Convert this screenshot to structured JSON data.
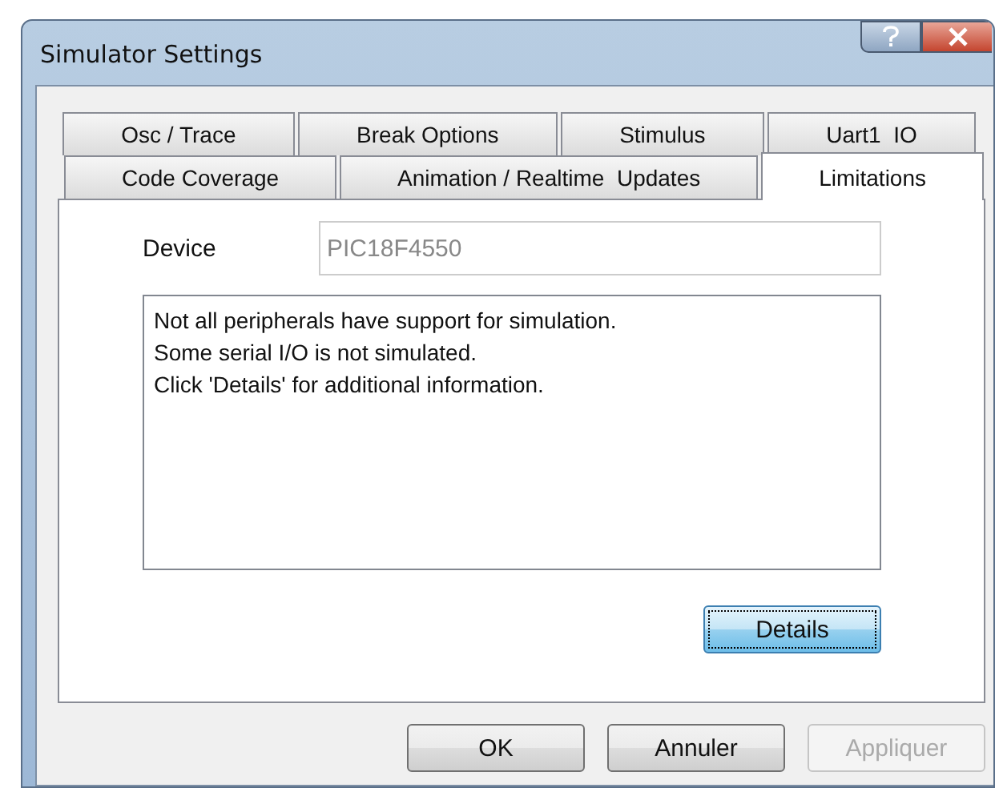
{
  "window": {
    "title": "Simulator Settings"
  },
  "tab_rows": [
    {
      "tabs": [
        {
          "label": "Osc / Trace",
          "selected": false
        },
        {
          "label": "Break Options",
          "selected": false
        },
        {
          "label": "Stimulus",
          "selected": false
        },
        {
          "label": "Uart1  IO",
          "selected": false
        }
      ]
    },
    {
      "tabs": [
        {
          "label": "Code Coverage",
          "selected": false
        },
        {
          "label": "Animation / Realtime  Updates",
          "selected": false
        },
        {
          "label": "Limitations",
          "selected": true
        }
      ]
    }
  ],
  "device": {
    "label": "Device",
    "value": "PIC18F4550",
    "disabled": true
  },
  "message_lines": [
    "Not all peripherals have support for simulation.",
    "Some serial I/O is not simulated.",
    "Click 'Details' for additional information."
  ],
  "details_button": {
    "label": "Details",
    "focused": true
  },
  "buttons": [
    {
      "label": "OK",
      "disabled": false
    },
    {
      "label": "Annuler",
      "disabled": false
    },
    {
      "label": "Appliquer",
      "disabled": true
    }
  ]
}
